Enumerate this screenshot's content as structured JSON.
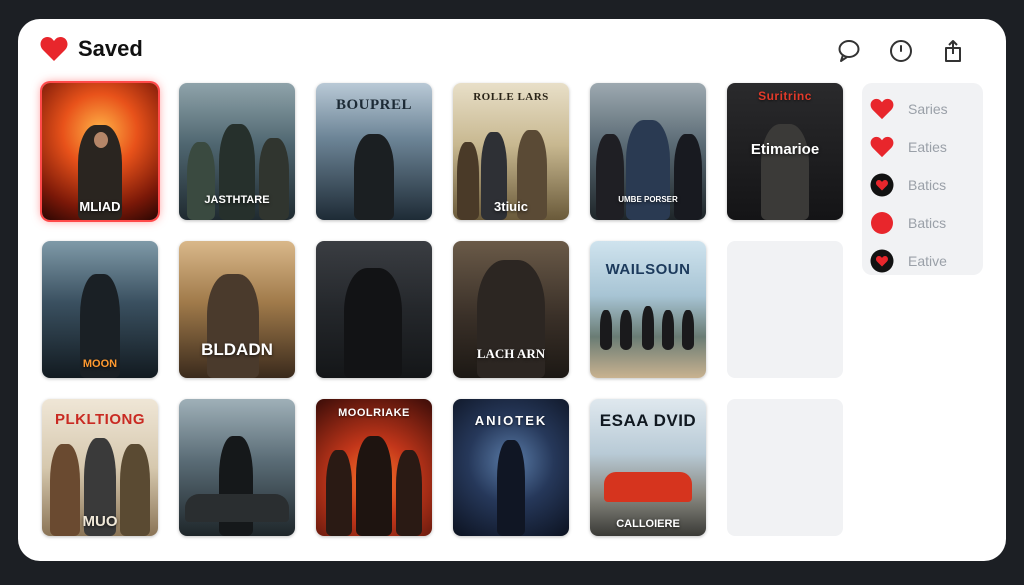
{
  "header": {
    "title": "Saved",
    "actions": [
      {
        "name": "chat-icon"
      },
      {
        "name": "clock-icon"
      },
      {
        "name": "share-icon"
      }
    ]
  },
  "posters": [
    {
      "top": "",
      "bottom": "MLIAD",
      "selected": true
    },
    {
      "top": "",
      "bottom": "JASTHTARE"
    },
    {
      "top": "BOUPREL",
      "bottom": ""
    },
    {
      "top": "ROLLE LARS",
      "bottom": "3tiuic"
    },
    {
      "top": "",
      "bottom": "UMBE PORSER"
    },
    {
      "top": "Suritrinc",
      "bottom": "Etimarioe"
    },
    {
      "top": "",
      "bottom": "MOON"
    },
    {
      "top": "",
      "bottom": "BLDADN"
    },
    {
      "top": "",
      "bottom": ""
    },
    {
      "top": "",
      "bottom": "LACH ARN"
    },
    {
      "top": "WAILSOUN",
      "bottom": ""
    },
    {
      "top": "PLKLTIONG",
      "bottom": "MUO"
    },
    {
      "top": "",
      "bottom": ""
    },
    {
      "top": "MOOLRIAKE",
      "bottom": ""
    },
    {
      "top": "ANIOTEK",
      "bottom": ""
    },
    {
      "top": "ESAA DVID",
      "bottom": "CALLOIERE"
    }
  ],
  "side_panel": {
    "items": [
      {
        "label": "Saries",
        "icon": "heart-icon"
      },
      {
        "label": "Eaties",
        "icon": "heart-icon"
      },
      {
        "label": "Batics",
        "icon": "heart-circle-icon"
      },
      {
        "label": "Batics",
        "icon": "red-dot-icon"
      },
      {
        "label": "Eative",
        "icon": "heart-circle-icon"
      }
    ]
  },
  "colors": {
    "accent": "#e8262c",
    "panel_bg": "#f1f2f4",
    "window_bg": "#ffffff",
    "page_bg": "#1c1f24"
  }
}
